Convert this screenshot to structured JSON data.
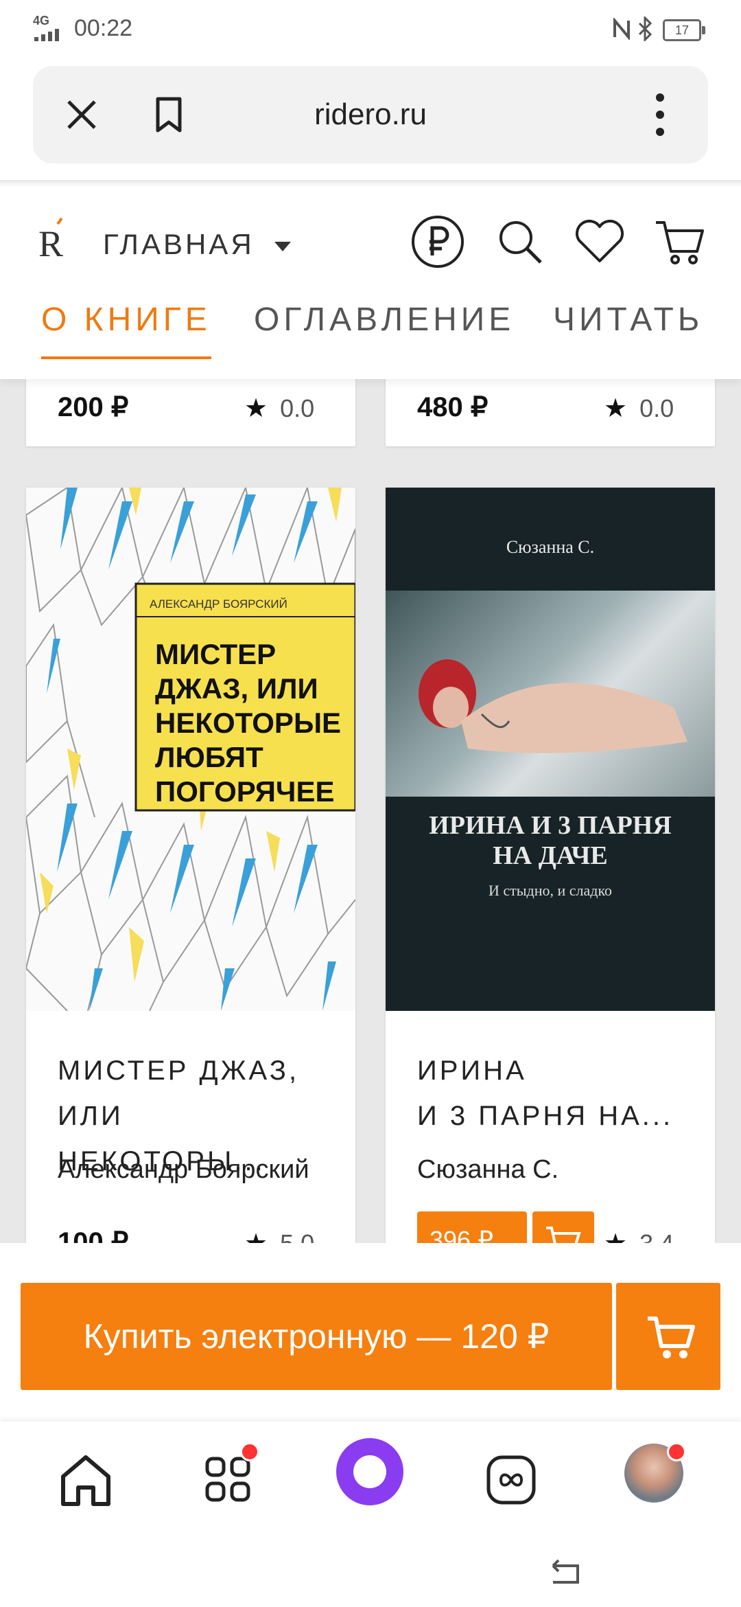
{
  "status_bar": {
    "network": "4G",
    "time": "00:22",
    "battery": "17"
  },
  "browser": {
    "url": "ridero.ru"
  },
  "site_header": {
    "logo": "R",
    "nav_label": "ГЛАВНАЯ",
    "tabs": [
      {
        "label": "О КНИГЕ",
        "active": true
      },
      {
        "label": "ОГЛАВЛЕНИЕ",
        "active": false
      },
      {
        "label": "ЧИТАТЬ",
        "active": false
      }
    ]
  },
  "books_top_row": [
    {
      "price": "200 ₽",
      "rating": "0.0"
    },
    {
      "price": "480 ₽",
      "rating": "0.0"
    }
  ],
  "books": [
    {
      "title_line1": "МИСТЕР ДЖАЗ,",
      "title_line2": "ИЛИ НЕКОТОРЫ...",
      "author": "Александр Боярский",
      "price": "100 ₽",
      "rating": "5.0",
      "cover": {
        "author": "АЛЕКСАНДР БОЯРСКИЙ",
        "title_lines": [
          "МИСТЕР",
          "ДЖАЗ, ИЛИ",
          "НЕКОТОРЫЕ",
          "ЛЮБЯТ",
          "ПОГОРЯЧЕЕ"
        ]
      }
    },
    {
      "title_line1": "ИРИНА",
      "title_line2": "И 3 ПАРНЯ НА...",
      "author": "Сюзанна С.",
      "price": "396 ₽",
      "rating": "3.4",
      "cover": {
        "author": "Сюзанна С.",
        "title_lines": [
          "ИРИНА И 3 ПАРНЯ",
          "НА ДАЧЕ"
        ],
        "subtitle": "И стыдно, и сладко"
      }
    }
  ],
  "buy_bar": {
    "label": "Купить электронную — 120 ₽"
  },
  "colors": {
    "accent": "#f57f0f",
    "alice": "#8a3cf0"
  }
}
